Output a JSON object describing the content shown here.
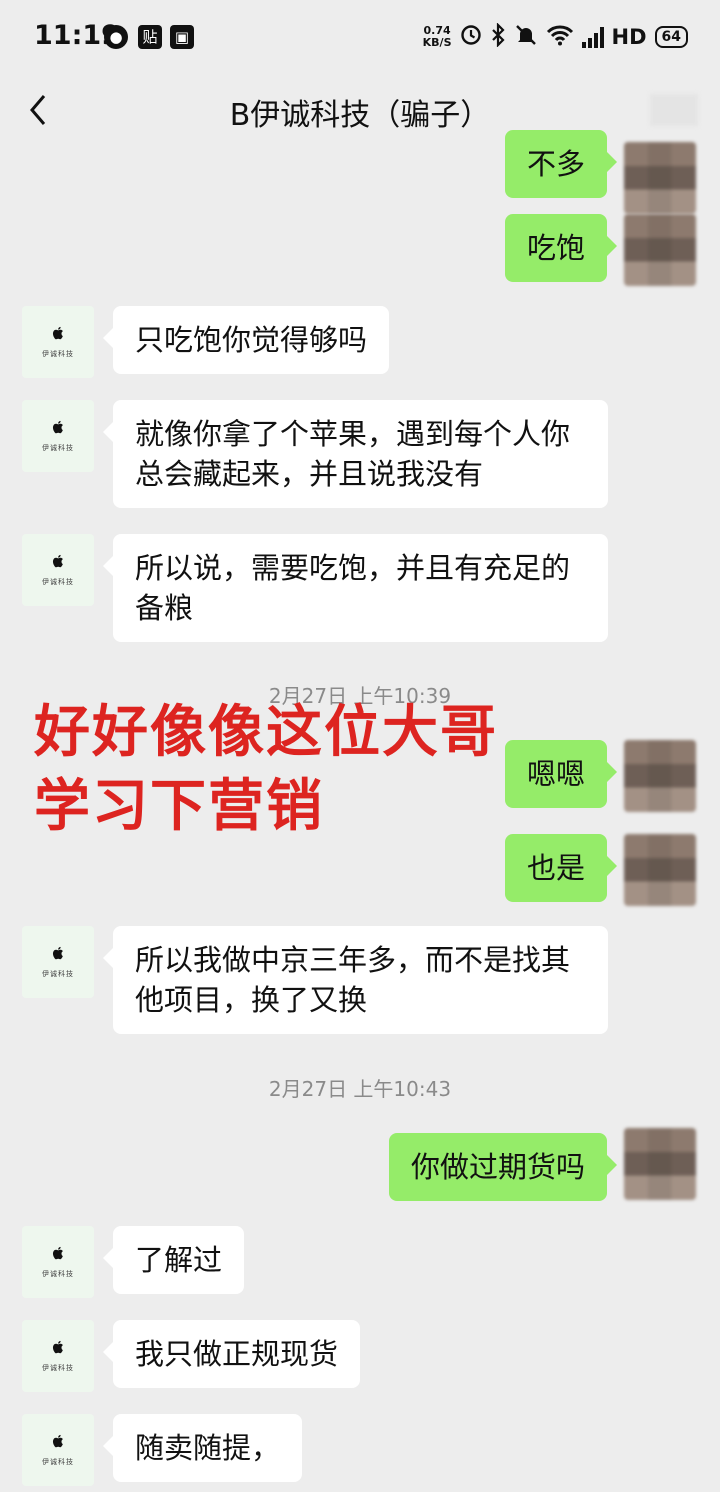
{
  "status_bar": {
    "time": "11:19",
    "speed_value": "0.74",
    "speed_unit": "KB/S",
    "network": "HD",
    "battery": "64"
  },
  "header": {
    "title": "B伊诚科技（骗子）"
  },
  "contact_avatar": {
    "caption": "伊诚科技"
  },
  "messages": [
    {
      "id": "m0",
      "from": "me",
      "text": "不多"
    },
    {
      "id": "m1",
      "from": "me",
      "text": "吃饱"
    },
    {
      "id": "m2",
      "from": "them",
      "text": "只吃饱你觉得够吗"
    },
    {
      "id": "m3",
      "from": "them",
      "text": "就像你拿了个苹果，遇到每个人你总会藏起来，并且说我没有"
    },
    {
      "id": "m4",
      "from": "them",
      "text": "所以说，需要吃饱，并且有充足的备粮"
    },
    {
      "id": "t1",
      "type": "time",
      "text": "2月27日 上午10:39"
    },
    {
      "id": "m5",
      "from": "me",
      "text": "嗯嗯"
    },
    {
      "id": "m6",
      "from": "me",
      "text": "也是"
    },
    {
      "id": "m7",
      "from": "them",
      "text": "所以我做中京三年多，而不是找其他项目，换了又换"
    },
    {
      "id": "t2",
      "type": "time",
      "text": "2月27日 上午10:43"
    },
    {
      "id": "m8",
      "from": "me",
      "text": "你做过期货吗"
    },
    {
      "id": "m9",
      "from": "them",
      "text": "了解过"
    },
    {
      "id": "m10",
      "from": "them",
      "text": "我只做正规现货"
    },
    {
      "id": "m11",
      "from": "them",
      "text": "随卖随提，"
    }
  ],
  "annotation": {
    "line1": "好好像像这位大哥",
    "line2": "学习下营销",
    "color": "#dd2420"
  },
  "colors": {
    "background": "#ededed",
    "outgoing_bubble": "#95ec69",
    "incoming_bubble": "#ffffff"
  }
}
